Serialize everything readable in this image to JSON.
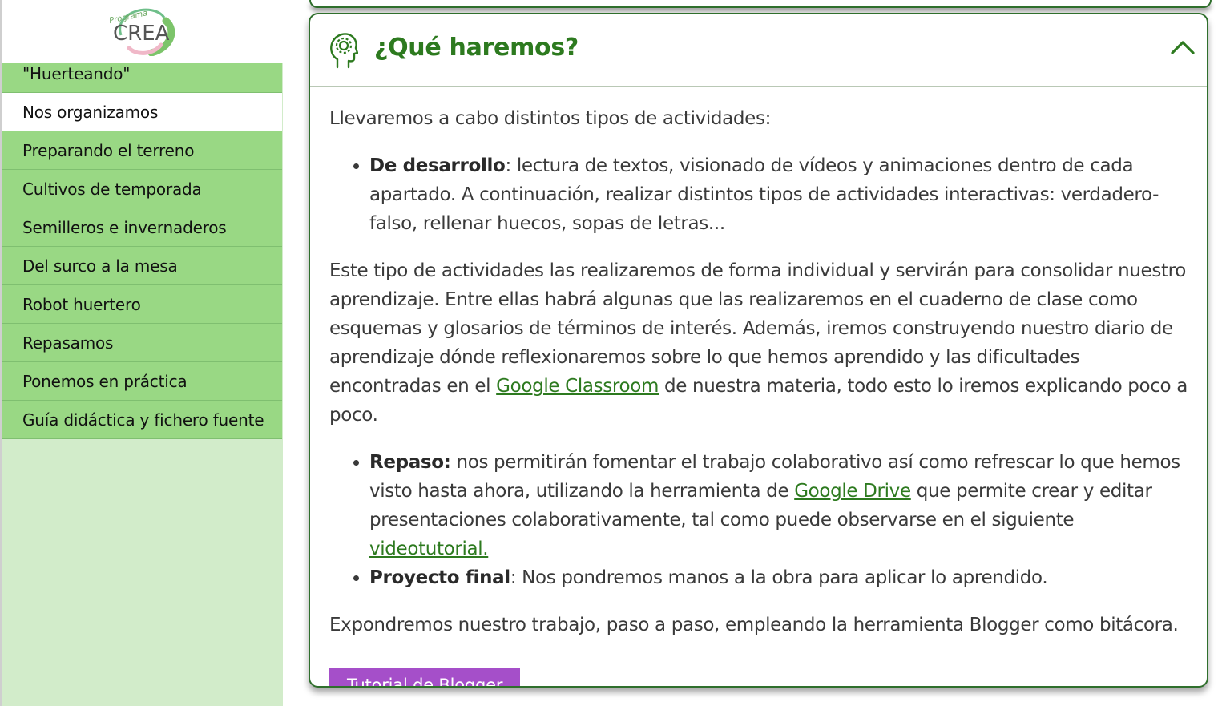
{
  "sidebar": {
    "logo_text": "CREA",
    "logo_subtext": "Programa",
    "items": [
      {
        "label": "\"Huerteando\"",
        "active": false
      },
      {
        "label": "Nos organizamos",
        "active": true
      },
      {
        "label": "Preparando el terreno",
        "active": false
      },
      {
        "label": "Cultivos de temporada",
        "active": false
      },
      {
        "label": "Semilleros e invernaderos",
        "active": false
      },
      {
        "label": "Del surco a la mesa",
        "active": false
      },
      {
        "label": "Robot huertero",
        "active": false
      },
      {
        "label": "Repasamos",
        "active": false
      },
      {
        "label": "Ponemos en práctica",
        "active": false
      },
      {
        "label": "Guía didáctica y fichero fuente",
        "active": false
      }
    ]
  },
  "card": {
    "icon": "head-gear-icon",
    "title": "¿Qué haremos?",
    "collapse_icon": "chevron-up-icon",
    "intro": "Llevaremos a cabo distintos tipos de actividades:",
    "item1_bold": "De desarrollo",
    "item1_text": ": lectura de textos, visionado de vídeos y animaciones dentro de cada apartado. A continuación, realizar distintos tipos de actividades interactivas: verdadero-falso, rellenar huecos, sopas de letras...",
    "para2_pre": "Este tipo de actividades las realizaremos de forma individual y servirán para consolidar nuestro aprendizaje. Entre ellas habrá algunas que las realizaremos en el cuaderno de clase como esquemas y glosarios de términos de interés. Además, iremos construyendo nuestro diario de aprendizaje dónde reflexionaremos sobre lo que hemos aprendido y las dificultades encontradas en el ",
    "para2_link": "Google Classroom",
    "para2_post": " de nuestra materia, todo esto lo iremos explicando poco a poco.",
    "item2_bold": "Repaso:",
    "item2_pre": " nos permitirán fomentar el trabajo colaborativo así como refrescar lo que hemos visto hasta ahora, utilizando la herramienta de ",
    "item2_link1": "Google Drive",
    "item2_mid": " que permite crear y editar presentaciones colaborativamente, tal como puede observarse en el siguiente ",
    "item2_link2": "videotutorial.",
    "item3_bold": "Proyecto final",
    "item3_text": ": Nos pondremos manos a la obra para aplicar lo aprendido.",
    "closing": "Expondremos nuestro trabajo, paso a paso, empleando la herramienta Blogger como bitácora.",
    "button_label": "Tutorial de Blogger"
  },
  "colors": {
    "accent_green": "#2d7a1f",
    "nav_green": "#99d884",
    "sidebar_bg": "#d2ecca",
    "button_purple": "#a54fc9"
  }
}
